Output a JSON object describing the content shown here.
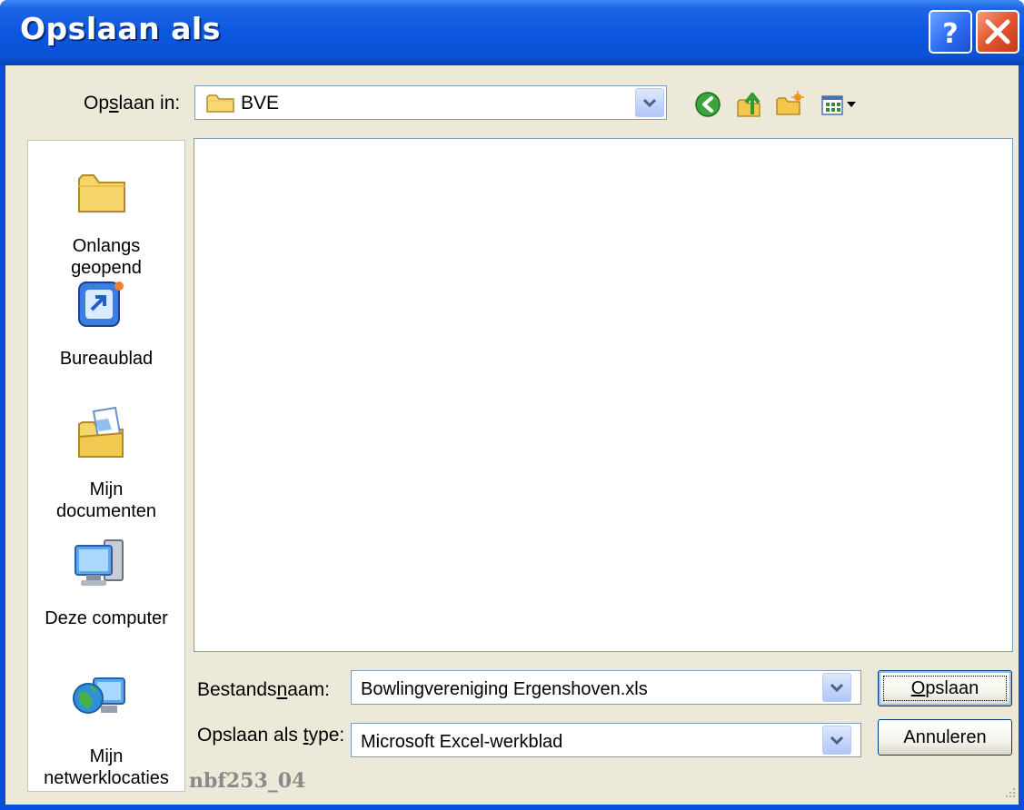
{
  "window": {
    "title": "Opslaan als",
    "help_button": "?",
    "close_button": "close"
  },
  "lookin": {
    "label_pre": "Op",
    "label_ul": "s",
    "label_post": "laan in:",
    "value": "BVE",
    "icon": "folder-icon"
  },
  "toolbar": {
    "icons": [
      "back-icon",
      "up-one-level-icon",
      "new-folder-icon",
      "views-menu-icon"
    ]
  },
  "places": [
    {
      "label": "Onlangs\ngeopend",
      "line1": "Onlangs",
      "line2": "geopend",
      "icon": "recent-folder-icon"
    },
    {
      "label": "Bureaublad",
      "line1": "Bureaublad",
      "line2": "",
      "icon": "desktop-icon"
    },
    {
      "label": "Mijn documenten",
      "line1": "Mijn",
      "line2": "documenten",
      "icon": "my-documents-icon"
    },
    {
      "label": "Deze computer",
      "line1": "Deze computer",
      "line2": "",
      "icon": "my-computer-icon"
    },
    {
      "label": "Mijn netwerklocaties",
      "line1": "Mijn",
      "line2": "netwerklocaties",
      "icon": "network-icon"
    }
  ],
  "filename": {
    "label_pre": "Bestands",
    "label_ul": "n",
    "label_post": "aam:",
    "value": "Bowlingvereniging Ergenshoven.xls"
  },
  "filetype": {
    "label_pre": "Opslaan als ",
    "label_ul": "t",
    "label_post": "ype:",
    "value": "Microsoft Excel-werkblad"
  },
  "buttons": {
    "save_ul": "O",
    "save_rest": "pslaan",
    "cancel": "Annuleren"
  },
  "footer_tag": "nbf253_04",
  "colors": {
    "titlebar": "#0a57df",
    "client": "#ece9d8",
    "close_button": "#e0552f"
  }
}
